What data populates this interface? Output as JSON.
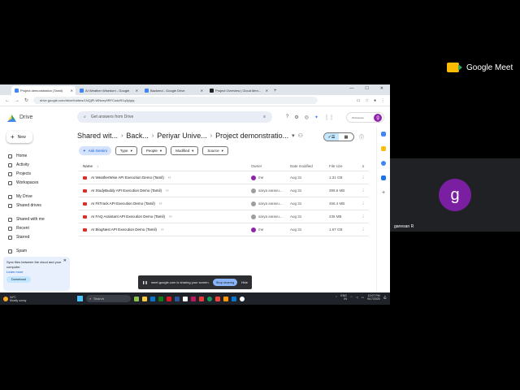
{
  "meet": {
    "brand": "Google Meet",
    "participant_initial": "g",
    "participant_name": "ganesan R"
  },
  "browser": {
    "tabs": [
      {
        "title": "Project demonstration (Tamil)",
        "active": true
      },
      {
        "title": "AI Weather Wisedom - Google",
        "active": false
      },
      {
        "title": "Backend - Google Drive",
        "active": false
      },
      {
        "title": "Project Overview | Cloud Men...",
        "active": false
      }
    ],
    "url": "drive.google.com/drive/folders/1NQjPl-WNcey9RFCudoR1q3ylpjq"
  },
  "drive": {
    "app_name": "Drive",
    "search_placeholder": "Get answers from Drive",
    "account_label": "Workspace",
    "account_initial": "g",
    "new_label": "New",
    "sidebar": [
      "Home",
      "Activity",
      "Projects",
      "Workspaces",
      "My Drive",
      "Shared drives",
      "Shared with me",
      "Recent",
      "Starred",
      "Spam"
    ],
    "sync": {
      "text": "Sync files between the cloud and your computer.",
      "learn_more": "Learn more",
      "download": "Download"
    },
    "breadcrumbs": [
      "Shared wit...",
      "Back...",
      "Periyar Unive...",
      "Project demonstratio..."
    ],
    "filters": [
      "Type",
      "People",
      "Modified",
      "Source"
    ],
    "ask_gemini": "Ask Gemini",
    "columns": {
      "name": "Name",
      "owner": "Owner",
      "date": "Date modified",
      "size": "File size"
    },
    "files": [
      {
        "name": "AI WeatherWise API Execution Demo (Tamil)",
        "owner": "me",
        "date": "Aug 31",
        "size": "1.31 GB"
      },
      {
        "name": "AI StudyBuddy API Execution Demo (Tamil)",
        "owner": "sarya saravu...",
        "date": "Aug 31",
        "size": "399.6 MB"
      },
      {
        "name": "AI FitTrack API Execution Demo (Tamil)",
        "owner": "sarya saravu...",
        "date": "Aug 31",
        "size": "456.4 MB"
      },
      {
        "name": "AI FAQ Assistant API Execution Demo (Tamil)",
        "owner": "sarya saravu...",
        "date": "Aug 31",
        "size": "436 MB"
      },
      {
        "name": "AI BlogNest API Execution Demo (Tamil)",
        "owner": "me",
        "date": "Aug 31",
        "size": "1.67 GB"
      }
    ]
  },
  "sharebar": {
    "text": "meet.google.com is sharing your screen.",
    "stop": "Stop sharing",
    "hide": "Hide"
  },
  "taskbar": {
    "temp": "34°C",
    "weather": "Mostly sunny",
    "search": "Search",
    "lang": "ENG",
    "region": "IN",
    "time": "12:07 PM",
    "date": "9/17/2025"
  }
}
